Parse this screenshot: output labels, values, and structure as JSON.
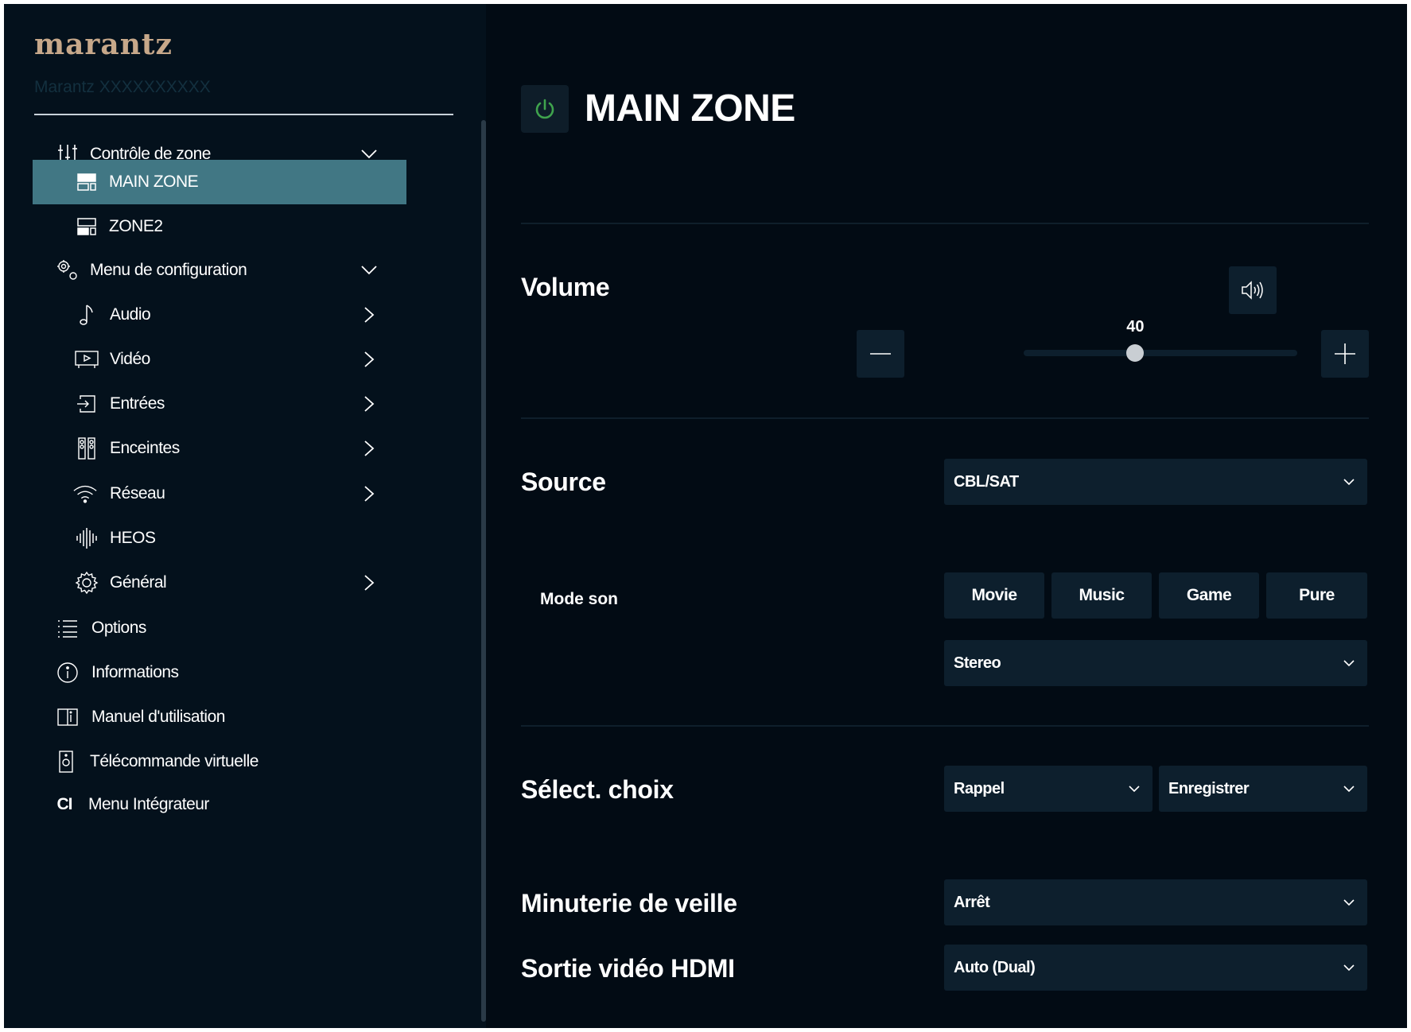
{
  "brand": {
    "logo": "marantz",
    "device_name": "Marantz XXXXXXXXXX"
  },
  "sidebar": {
    "items": [
      {
        "label": "Contrôle de zone",
        "icon": "sliders-icon",
        "expandable": true
      },
      {
        "label": "MAIN ZONE",
        "icon": "zone-icon",
        "active": true
      },
      {
        "label": "ZONE2",
        "icon": "zone-icon"
      },
      {
        "label": "Menu de configuration",
        "icon": "gears-icon",
        "expandable": true
      },
      {
        "label": "Audio",
        "icon": "music-note-icon"
      },
      {
        "label": "Vidéo",
        "icon": "video-icon"
      },
      {
        "label": "Entrées",
        "icon": "input-icon"
      },
      {
        "label": "Enceintes",
        "icon": "speakers-icon"
      },
      {
        "label": "Réseau",
        "icon": "wifi-icon"
      },
      {
        "label": "HEOS",
        "icon": "heos-icon"
      },
      {
        "label": "Général",
        "icon": "gear-icon"
      },
      {
        "label": "Options",
        "icon": "list-icon"
      },
      {
        "label": "Informations",
        "icon": "info-icon"
      },
      {
        "label": "Manuel d'utilisation",
        "icon": "book-icon"
      },
      {
        "label": "Télécommande virtuelle",
        "icon": "remote-icon"
      },
      {
        "label": "Menu Intégrateur",
        "icon_text": "CI"
      }
    ]
  },
  "main": {
    "title": "MAIN ZONE",
    "power_color": "#3fa34d",
    "volume": {
      "label": "Volume",
      "value": "40",
      "level": 40,
      "max": 98
    },
    "source": {
      "label": "Source",
      "selected": "CBL/SAT"
    },
    "sound_mode": {
      "label": "Mode son",
      "buttons": [
        "Movie",
        "Music",
        "Game",
        "Pure"
      ],
      "selected": "Stereo"
    },
    "quick_select": {
      "label": "Sélect. choix",
      "recall": "Rappel",
      "save": "Enregistrer"
    },
    "sleep_timer": {
      "label": "Minuterie de veille",
      "selected": "Arrêt"
    },
    "hdmi_out": {
      "label": "Sortie vidéo HDMI",
      "selected": "Auto (Dual)"
    }
  },
  "colors": {
    "background": "#020b14",
    "sidebar": "#04111c",
    "active": "#417784",
    "control": "#0d1f2d",
    "logo": "#c7a88a"
  }
}
